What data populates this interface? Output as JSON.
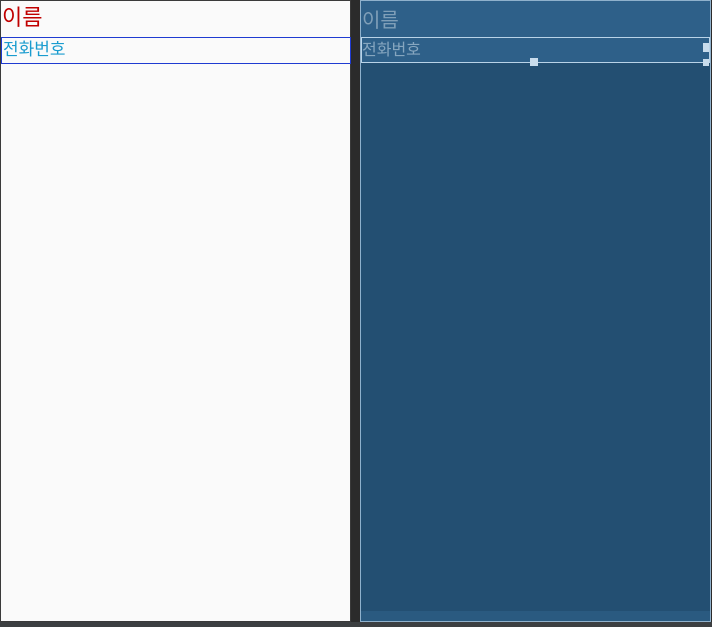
{
  "design_view": {
    "name_text": "이름",
    "phone_text": "전화번호"
  },
  "blueprint_view": {
    "name_text": "이름",
    "phone_text": "전화번호"
  },
  "colors": {
    "design_background": "#fafafa",
    "name_text_color": "#c00000",
    "phone_text_color": "#1a9ccf",
    "phone_border_color": "#1f3bd1",
    "blueprint_background": "#234f72",
    "blueprint_highlight": "#2e6089",
    "blueprint_text": "#86a6bf",
    "editor_background": "#2b2b2b"
  }
}
